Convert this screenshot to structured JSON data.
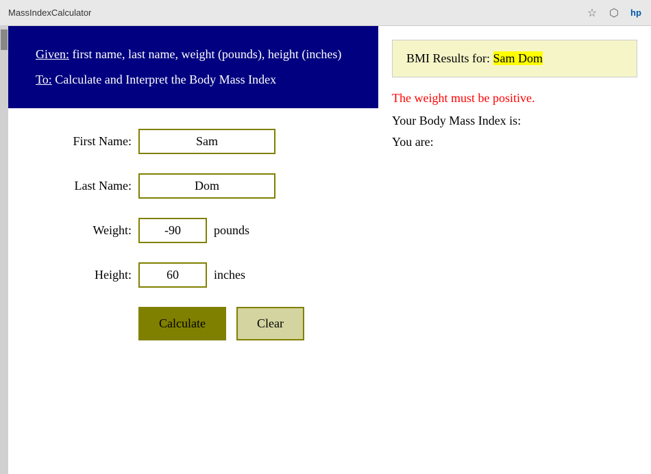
{
  "browser": {
    "title": "MassIndexCalculator",
    "star_icon": "☆",
    "cube_icon": "⬡",
    "hp_icon": "hp"
  },
  "header": {
    "given_label": "Given:",
    "given_text": " first name, last name, weight (pounds), height (inches)",
    "to_label": "To:",
    "to_text": " Calculate and Interpret the Body Mass Index"
  },
  "form": {
    "first_name_label": "First Name:",
    "first_name_value": "Sam",
    "last_name_label": "Last Name:",
    "last_name_value": "Dom",
    "weight_label": "Weight:",
    "weight_value": "-90",
    "weight_unit": "pounds",
    "height_label": "Height:",
    "height_value": "60",
    "height_unit": "inches",
    "calculate_button": "Calculate",
    "clear_button": "Clear"
  },
  "results": {
    "title_prefix": "BMI Results for: ",
    "name_highlighted": "Sam Dom",
    "error_message": "The weight must be positive.",
    "bmi_label": "Your Body Mass Index is:",
    "bmi_value": "",
    "category_label": "You are:",
    "category_value": ""
  }
}
